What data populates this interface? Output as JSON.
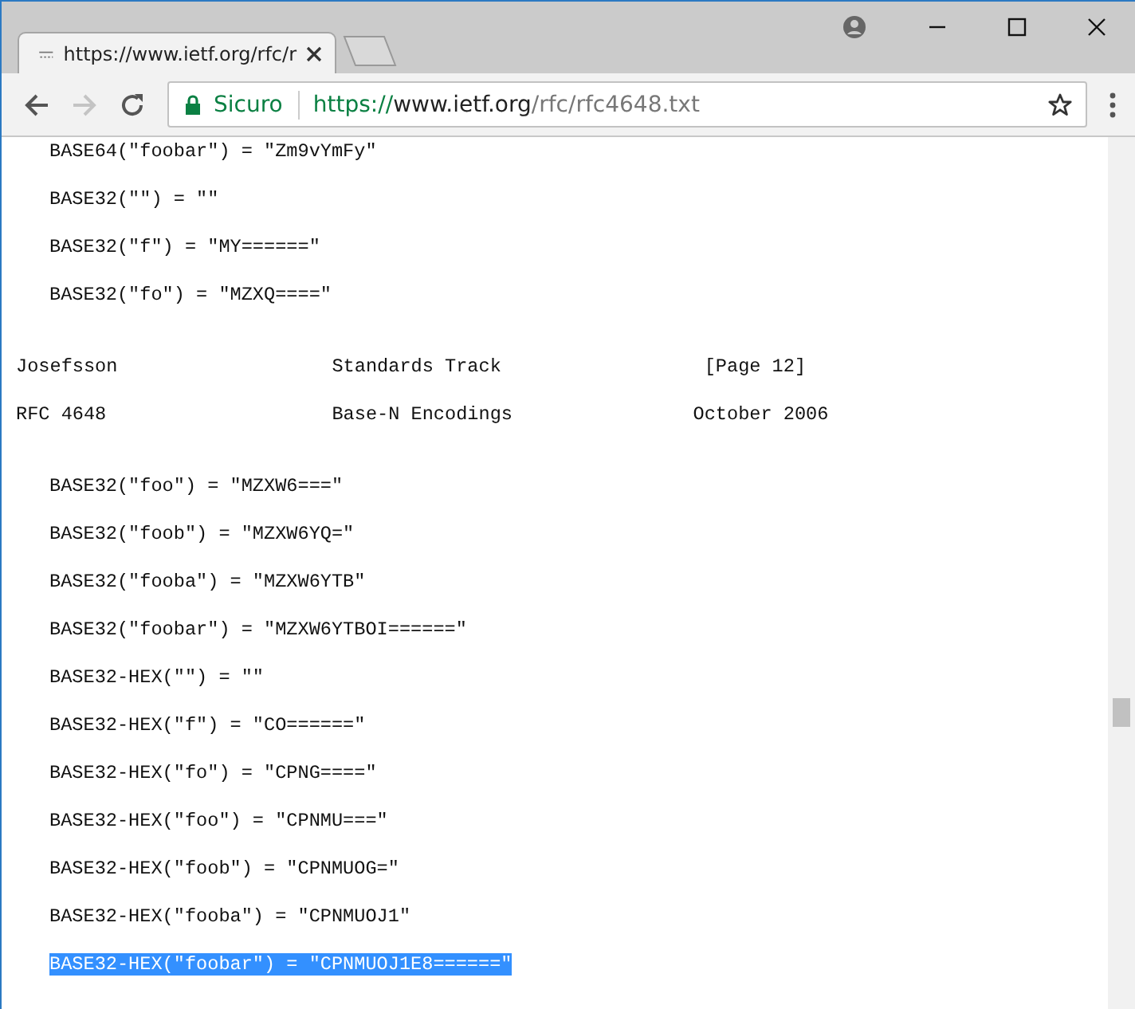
{
  "tabs": [
    {
      "title": "https://www.ietf.org/rfc/r",
      "selected": true
    }
  ],
  "address_bar": {
    "security_label": "Sicuro",
    "url_scheme": "https://",
    "url_host": "www.ietf.org",
    "url_path": "/rfc/rfc4648.txt"
  },
  "document_lines": [
    {
      "kind": "code",
      "text": "BASE64(\"foobar\") = \"Zm9vYmFy\"",
      "selected": false
    },
    {
      "kind": "code",
      "text": "BASE32(\"\") = \"\"",
      "selected": false
    },
    {
      "kind": "code",
      "text": "BASE32(\"f\") = \"MY======\"",
      "selected": false
    },
    {
      "kind": "code",
      "text": "BASE32(\"fo\") = \"MZXQ====\"",
      "selected": false
    },
    {
      "kind": "footer",
      "text": "Josefsson                   Standards Track                  [Page 12]",
      "selected": false
    },
    {
      "kind": "header",
      "text": "RFC 4648                    Base-N Encodings                October 2006",
      "selected": false
    },
    {
      "kind": "code",
      "text": "BASE32(\"foo\") = \"MZXW6===\"",
      "selected": false
    },
    {
      "kind": "code",
      "text": "BASE32(\"foob\") = \"MZXW6YQ=\"",
      "selected": false
    },
    {
      "kind": "code",
      "text": "BASE32(\"fooba\") = \"MZXW6YTB\"",
      "selected": false
    },
    {
      "kind": "code",
      "text": "BASE32(\"foobar\") = \"MZXW6YTBOI======\"",
      "selected": false
    },
    {
      "kind": "code",
      "text": "BASE32-HEX(\"\") = \"\"",
      "selected": false
    },
    {
      "kind": "code",
      "text": "BASE32-HEX(\"f\") = \"CO======\"",
      "selected": false
    },
    {
      "kind": "code",
      "text": "BASE32-HEX(\"fo\") = \"CPNG====\"",
      "selected": false
    },
    {
      "kind": "code",
      "text": "BASE32-HEX(\"foo\") = \"CPNMU===\"",
      "selected": false
    },
    {
      "kind": "code",
      "text": "BASE32-HEX(\"foob\") = \"CPNMUOG=\"",
      "selected": false
    },
    {
      "kind": "code",
      "text": "BASE32-HEX(\"fooba\") = \"CPNMUOJ1\"",
      "selected": false
    },
    {
      "kind": "code",
      "text": "BASE32-HEX(\"foobar\") = \"CPNMUOJ1E8======\"",
      "selected": true
    }
  ]
}
